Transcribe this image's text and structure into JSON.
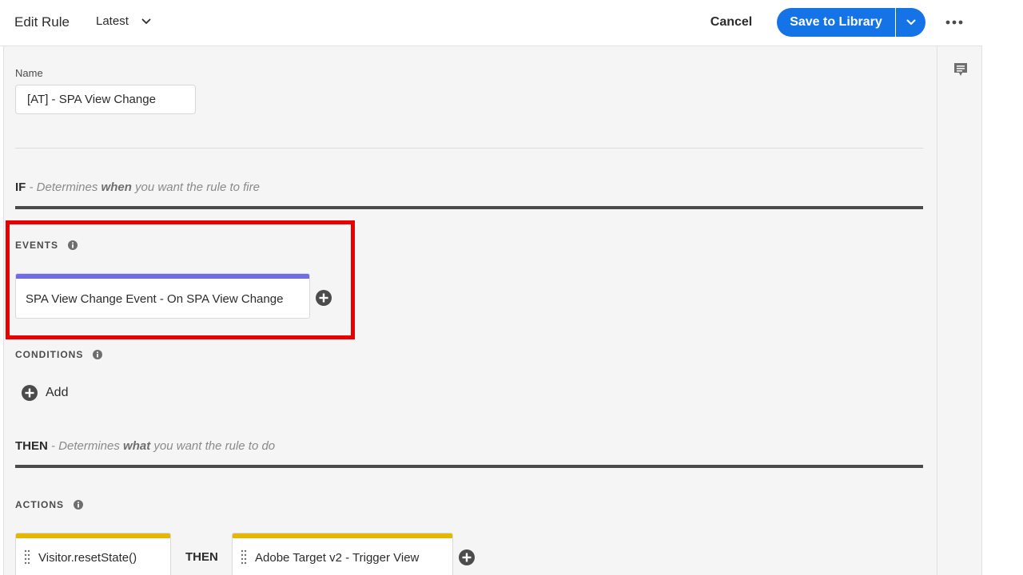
{
  "header": {
    "title": "Edit Rule",
    "version_label": "Latest",
    "cancel_label": "Cancel",
    "save_label": "Save to Library",
    "more_icon": "more-icon"
  },
  "form": {
    "name_label": "Name",
    "name_value": "[AT] - SPA View Change"
  },
  "if_section": {
    "keyword": "IF",
    "desc_pre": " - Determines ",
    "desc_em": "when",
    "desc_post": " you want the rule to fire"
  },
  "events": {
    "label": "EVENTS",
    "items": [
      {
        "text": "SPA View Change Event - On SPA View Change",
        "accent": "#6e6de7"
      }
    ]
  },
  "conditions": {
    "label": "CONDITIONS",
    "add_label": "Add"
  },
  "then_section": {
    "keyword": "THEN",
    "desc_pre": " - Determines ",
    "desc_em": "what",
    "desc_post": " you want the rule to do"
  },
  "actions": {
    "label": "ACTIONS",
    "items": [
      {
        "text": "Visitor.resetState()",
        "accent": "#e4b800"
      },
      {
        "text": "Adobe Target v2 - Trigger View",
        "accent": "#e4b800"
      }
    ],
    "connector": "THEN"
  },
  "colors": {
    "primary": "#1473e6",
    "highlight": "#e90000",
    "event_accent": "#6e6de7",
    "action_accent": "#e4b800"
  }
}
